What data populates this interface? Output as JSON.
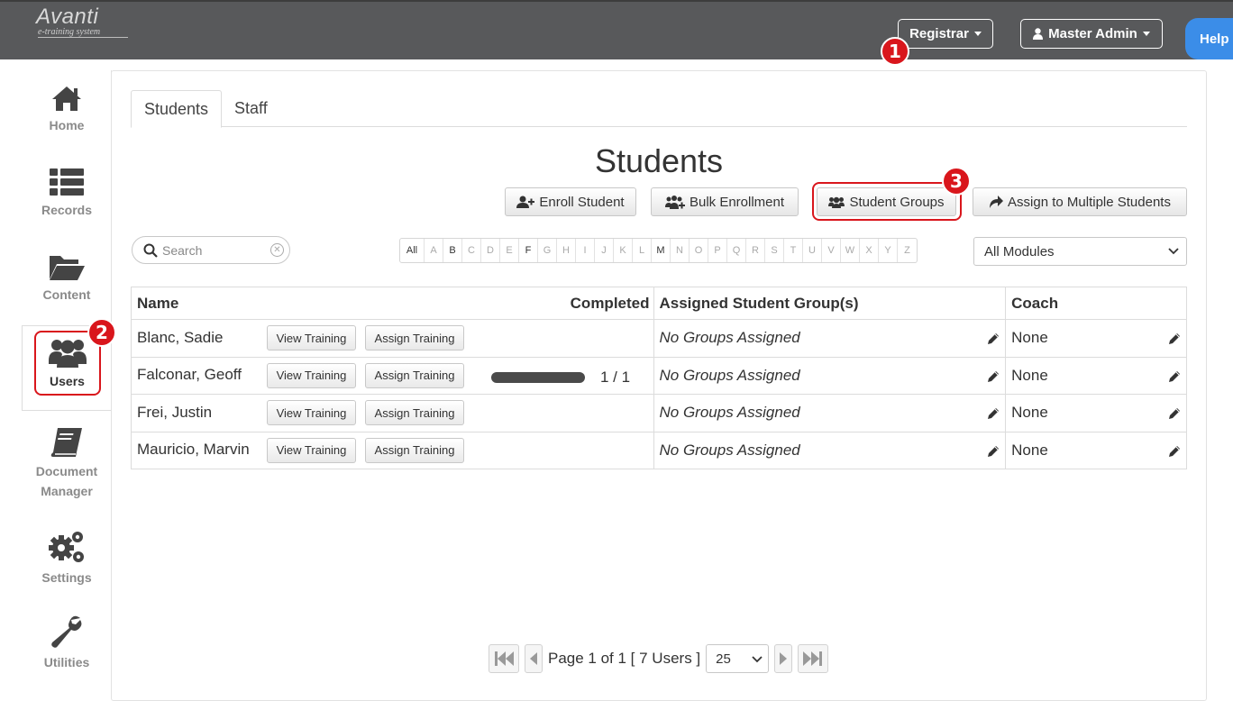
{
  "app": {
    "logo_brand": "Avanti",
    "logo_tagline": "e-training system"
  },
  "topbar": {
    "registrar_label": "Registrar",
    "admin_label": "Master Admin",
    "help_label": "Help"
  },
  "callouts": [
    "1",
    "2",
    "3"
  ],
  "sidebar": {
    "items": [
      {
        "label": "Home",
        "icon": "home-icon"
      },
      {
        "label": "Records",
        "icon": "list-icon"
      },
      {
        "label": "Content",
        "icon": "folder-icon"
      },
      {
        "label": "Users",
        "icon": "users-icon",
        "active": true
      },
      {
        "label": "Document Manager",
        "icon": "book-icon"
      },
      {
        "label": "Settings",
        "icon": "gears-icon"
      },
      {
        "label": "Utilities",
        "icon": "wrench-icon"
      }
    ]
  },
  "tabs": [
    {
      "label": "Students",
      "active": true
    },
    {
      "label": "Staff",
      "active": false
    }
  ],
  "page_title": "Students",
  "actions": {
    "enroll": "Enroll Student",
    "bulk": "Bulk Enrollment",
    "groups": "Student Groups",
    "assign_multi": "Assign to Multiple Students"
  },
  "search": {
    "placeholder": "Search"
  },
  "alphabet": {
    "all_label": "All",
    "letters": [
      "A",
      "B",
      "C",
      "D",
      "E",
      "F",
      "G",
      "H",
      "I",
      "J",
      "K",
      "L",
      "M",
      "N",
      "O",
      "P",
      "Q",
      "R",
      "S",
      "T",
      "U",
      "V",
      "W",
      "X",
      "Y",
      "Z"
    ],
    "active_letters": [
      "B",
      "F",
      "M"
    ]
  },
  "module_filter": {
    "selected": "All Modules"
  },
  "table": {
    "headers": {
      "name": "Name",
      "completed": "Completed",
      "groups": "Assigned Student Group(s)",
      "coach": "Coach"
    },
    "view_label": "View Training",
    "assign_label": "Assign Training",
    "rows": [
      {
        "name": "Blanc, Sadie",
        "completed": "",
        "groups": "No Groups Assigned",
        "coach": "None"
      },
      {
        "name": "Falconar, Geoff",
        "completed": "1 / 1",
        "progress": 1.0,
        "groups": "No Groups Assigned",
        "coach": "None"
      },
      {
        "name": "Frei, Justin",
        "completed": "",
        "groups": "No Groups Assigned",
        "coach": "None"
      },
      {
        "name": "Mauricio, Marvin",
        "completed": "",
        "groups": "No Groups Assigned",
        "coach": "None"
      }
    ]
  },
  "pager": {
    "info": "Page 1 of 1 [ 7 Users ]",
    "page_size": "25"
  },
  "colors": {
    "topbar": "#58595b",
    "callout": "#d9161c",
    "help": "#3b8de8"
  }
}
